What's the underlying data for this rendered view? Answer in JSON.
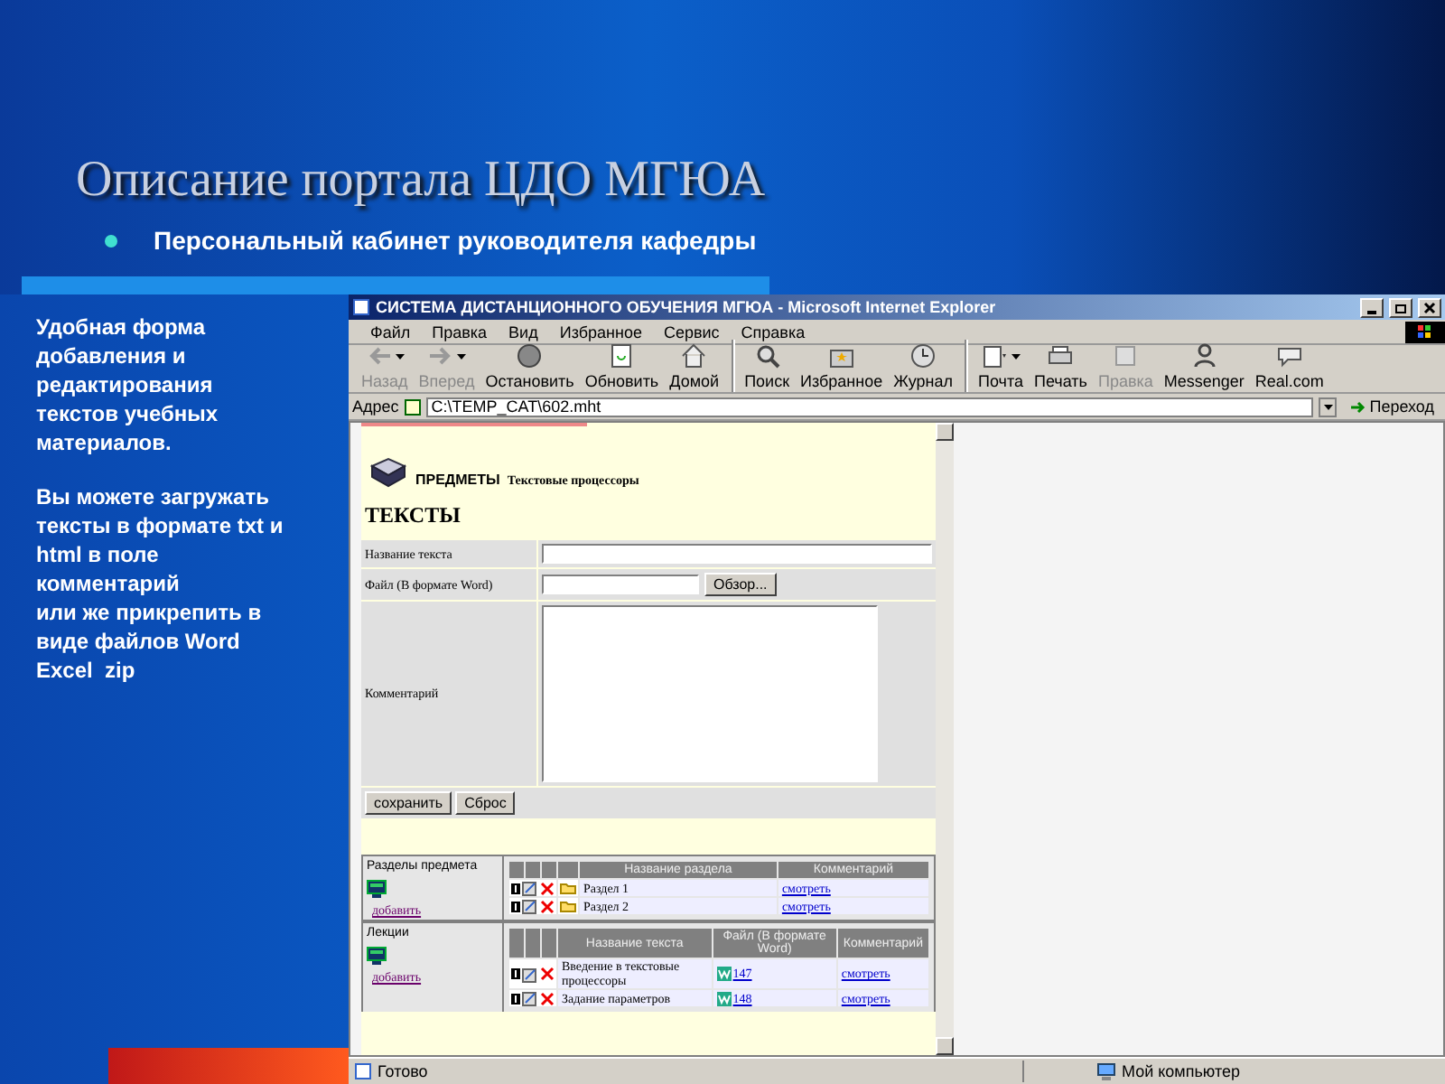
{
  "slide": {
    "title": "Описание портала ЦДО МГЮА",
    "bullet": "Персональный кабинет руководителя кафедры"
  },
  "note": {
    "paragraphs": [
      "Удобная форма добавления и редактирования текстов учебных материалов.",
      "Вы можете загружать тексты в формате txt и html в поле комментарий\nили же прикрепить в виде файлов Word Excel  zip"
    ]
  },
  "browser": {
    "title": "СИСТЕМА ДИСТАНЦИОННОГО ОБУЧЕНИЯ МГЮА - Microsoft Internet Explorer",
    "menu": [
      "Файл",
      "Правка",
      "Вид",
      "Избранное",
      "Сервис",
      "Справка"
    ],
    "toolbar": [
      {
        "label": "Назад",
        "disabled": true,
        "dropdown": true,
        "separator_before": false
      },
      {
        "label": "Вперед",
        "disabled": true,
        "dropdown": true,
        "separator_before": false
      },
      {
        "label": "Остановить",
        "disabled": false,
        "dropdown": false,
        "separator_before": false
      },
      {
        "label": "Обновить",
        "disabled": false,
        "dropdown": false,
        "separator_before": false
      },
      {
        "label": "Домой",
        "disabled": false,
        "dropdown": false,
        "separator_before": false
      },
      {
        "label": "Поиск",
        "disabled": false,
        "dropdown": false,
        "separator_before": true
      },
      {
        "label": "Избранное",
        "disabled": false,
        "dropdown": false,
        "separator_before": false
      },
      {
        "label": "Журнал",
        "disabled": false,
        "dropdown": false,
        "separator_before": false
      },
      {
        "label": "Почта",
        "disabled": false,
        "dropdown": true,
        "separator_before": true
      },
      {
        "label": "Печать",
        "disabled": false,
        "dropdown": false,
        "separator_before": false
      },
      {
        "label": "Правка",
        "disabled": true,
        "dropdown": false,
        "separator_before": false
      },
      {
        "label": "Messenger",
        "disabled": false,
        "dropdown": false,
        "separator_before": false
      },
      {
        "label": "Real.com",
        "disabled": false,
        "dropdown": false,
        "separator_before": false
      }
    ],
    "address": {
      "label": "Адрес",
      "value": "C:\\TEMP_CAT\\602.mht",
      "go": "Переход"
    },
    "status": {
      "text": "Готово",
      "zone": "Мой компьютер"
    }
  },
  "page": {
    "section": "ПРЕДМЕТЫ",
    "subject": "Текстовые процессоры",
    "heading": "ТЕКСТЫ",
    "form": {
      "fields": [
        {
          "kind": "text",
          "label": "Название текста"
        },
        {
          "kind": "file",
          "label": "Файл (В формате Word)",
          "button": "Обзор..."
        },
        {
          "kind": "textarea",
          "label": "Комментарий"
        }
      ],
      "buttons": [
        "сохранить",
        "Сброс"
      ]
    },
    "sections": {
      "title": "Разделы предмета",
      "add": "добавить",
      "columns": [
        "Название раздела",
        "Комментарий"
      ],
      "rows": [
        {
          "name": "Раздел 1",
          "comment": "смотреть"
        },
        {
          "name": "Раздел 2",
          "comment": "смотреть"
        }
      ]
    },
    "lectures": {
      "title": "Лекции",
      "add": "добавить",
      "columns": [
        "Название текста",
        "Файл (В формате Word)",
        "Комментарий"
      ],
      "rows": [
        {
          "name": "Введение в текстовые процессоры",
          "file": "147",
          "comment": "смотреть"
        },
        {
          "name": "Задание параметров",
          "file": "148",
          "comment": "смотреть"
        }
      ]
    }
  }
}
